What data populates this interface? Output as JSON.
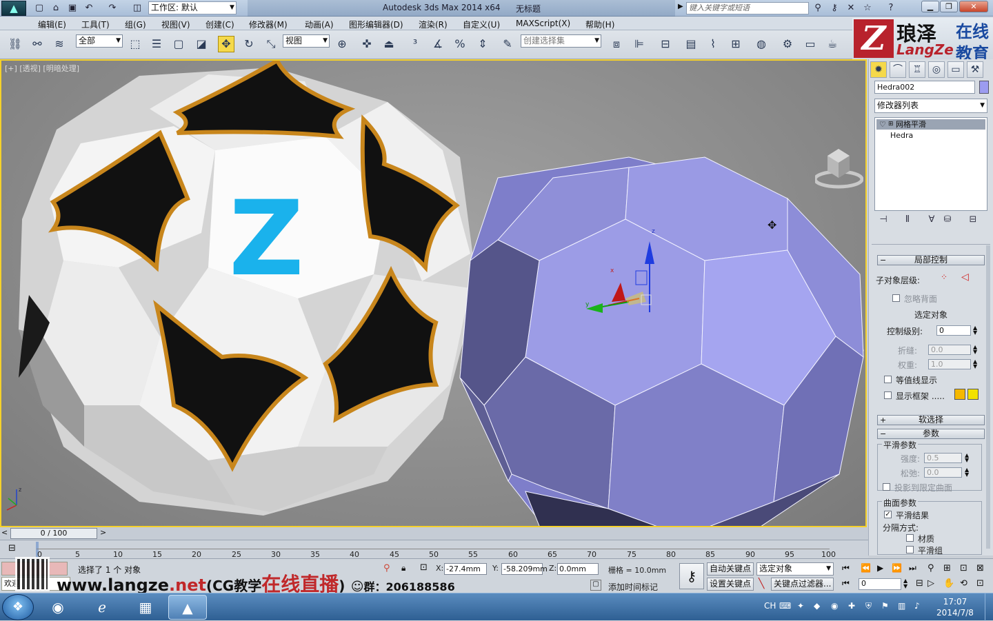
{
  "app": {
    "title": "Autodesk 3ds Max  2014 x64",
    "document": "无标题",
    "workspace_label": "工作区: 默认",
    "search_placeholder": "键入关键字或短语"
  },
  "menu": [
    "编辑(E)",
    "工具(T)",
    "组(G)",
    "视图(V)",
    "创建(C)",
    "修改器(M)",
    "动画(A)",
    "图形编辑器(D)",
    "渲染(R)",
    "自定义(U)",
    "MAXScript(X)",
    "帮助(H)"
  ],
  "toolbar": {
    "selection_filter": "全部",
    "ref_coord": "视图",
    "named_selection": "创建选择集"
  },
  "brand": {
    "z": "Z",
    "cn1": "琅泽",
    "cn2": "在线",
    "en": "LangZe",
    "cn3": "教育"
  },
  "viewport": {
    "label_plus": "[+]",
    "label_view": "[透视]",
    "label_shading": "[明暗处理]",
    "gizmo_z": "z",
    "gizmo_x": "x",
    "gizmo_y": "y",
    "logo_letter": "Z",
    "object_color": "#9c9cf0",
    "accent": "#f5d12a"
  },
  "command_panel": {
    "object_name": "Hedra002",
    "modifier_list": "修改器列表",
    "stack": {
      "modifier": "网格平滑",
      "base": "Hedra"
    },
    "local_control": {
      "title": "局部控制",
      "subobject_label": "子对象层级:",
      "ignore_backface": "忽略背面",
      "selection_label": "选定对象",
      "control_level_label": "控制级别:",
      "control_level": "0",
      "crease_label": "折缝:",
      "crease": "0.0",
      "weight_label": "权重:",
      "weight": "1.0",
      "isoline": "等值线显示",
      "show_cage": "显示框架 ....."
    },
    "soft_selection": "软选择",
    "parameters": {
      "title": "参数",
      "smooth_group": "平滑参数",
      "strength_label": "强度:",
      "strength": "0.5",
      "relax_label": "松弛:",
      "relax": "0.0",
      "project": "投影到限定曲面",
      "surface_group": "曲面参数",
      "smooth_result": "平滑结果",
      "separate_by": "分隔方式:",
      "materials": "材质",
      "smoothing_groups": "平滑组"
    },
    "cage_colors": [
      "#f5b800",
      "#f2e200"
    ]
  },
  "timeline": {
    "slider": "0 / 100",
    "ticks": [
      "0",
      "5",
      "10",
      "15",
      "20",
      "25",
      "30",
      "35",
      "40",
      "45",
      "50",
      "55",
      "60",
      "65",
      "70",
      "75",
      "80",
      "85",
      "90",
      "95",
      "100"
    ]
  },
  "status": {
    "selected": "选择了 1 个 对象",
    "welcome": "欢迎",
    "x_label": "X:",
    "x": "-27.4mm",
    "y_label": "Y:",
    "y": "-58.209mm",
    "z_label": "Z:",
    "z": "0.0mm",
    "grid": "栅格 = 10.0mm",
    "add_time_tag": "添加时间标记",
    "auto_key": "自动关键点",
    "set_key": "设置关键点",
    "key_mode": "选定对象",
    "key_filters": "关键点过滤器...",
    "frame": "0"
  },
  "watermark": {
    "www": "www.langze",
    "net": ".net",
    "cg": "(CG教学",
    "live": "在线直播",
    "close": ")",
    "group": "群：206188586"
  },
  "taskbar": {
    "time": "17:07",
    "date": "2014/7/8",
    "ime": "CH"
  }
}
